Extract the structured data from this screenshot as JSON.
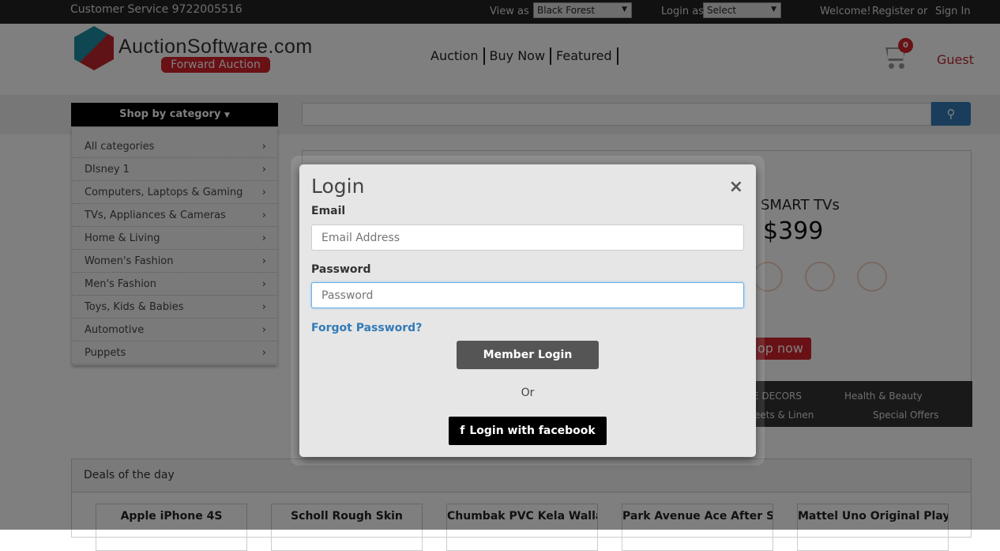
{
  "topbar": {
    "customer_service": "Customer Service 9722005516",
    "view_as_label": "View as",
    "view_as_value": "Black Forest",
    "login_as_label": "Login as",
    "login_as_value": "Select",
    "welcome": "Welcome!",
    "register": "Register",
    "or": "or",
    "sign_in": "Sign In"
  },
  "header": {
    "logo_name": "AuctionSoftware.com",
    "logo_tag": "Forward Auction",
    "nav": [
      "Auction",
      "Buy Now",
      "Featured"
    ],
    "cart_count": "0",
    "user": "Guest"
  },
  "search": {
    "shop_by": "Shop by category",
    "placeholder": ""
  },
  "categories": [
    "All categories",
    "DIsney 1",
    "Computers, Laptops & Gaming",
    "TVs, Appliances & Cameras",
    "Home & Living",
    "Women's Fashion",
    "Men's Fashion",
    "Toys, Kids & Babies",
    "Automotive",
    "Puppets"
  ],
  "banner": {
    "title": "SMART TVs",
    "price": "$399",
    "cta": "op now",
    "strip": [
      "E DECORS",
      "eets & Linen",
      "Health & Beauty",
      "Special Offers"
    ]
  },
  "deals": {
    "title": "Deals of the day",
    "items": [
      "Apple iPhone 4S",
      "Scholl Rough Skin",
      "Chumbak PVC Kela Wallah",
      "Park Avenue Ace After Sha",
      "Mattel Uno Original Playi"
    ]
  },
  "modal": {
    "title": "Login",
    "close": "×",
    "email_label": "Email",
    "email_placeholder": "Email Address",
    "password_label": "Password",
    "password_placeholder": "Password",
    "forgot": "Forgot Password?",
    "member_login": "Member Login",
    "or": "Or",
    "facebook_icon": "f",
    "facebook": "Login with facebook"
  },
  "colors": {
    "accent": "#d2232a",
    "link": "#337ab7"
  }
}
